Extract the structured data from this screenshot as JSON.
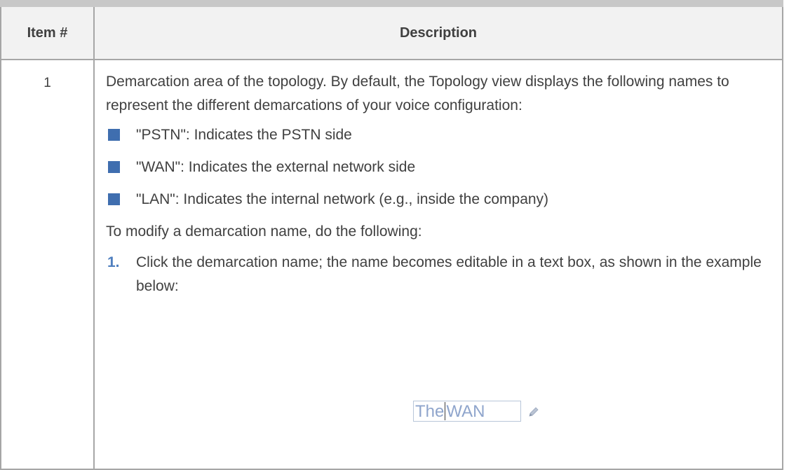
{
  "table": {
    "header": {
      "item_label": "Item #",
      "description_label": "Description"
    },
    "rows": [
      {
        "item": "1",
        "intro": "Demarcation area of the topology. By default, the Topology view displays the following names to represent the different demarcations of your voice configuration:",
        "bullets": [
          "\"PSTN\": Indicates the PSTN side",
          "\"WAN\": Indicates the external network side",
          "\"LAN\": Indicates the internal network (e.g., inside the company)"
        ],
        "instruction": "To modify a demarcation name, do the following:",
        "steps": [
          {
            "number": "1.",
            "text": "Click the demarcation name; the name becomes editable in a text box, as shown in the example below:"
          }
        ],
        "example": {
          "text_before_caret": "The",
          "text_after_caret": "WAN",
          "icon": "pencil-icon"
        }
      }
    ]
  },
  "colors": {
    "bullet": "#3f6eaf",
    "step_number": "#4f7fbf",
    "border": "#a6a6a6",
    "header_bg": "#f2f2f2"
  }
}
